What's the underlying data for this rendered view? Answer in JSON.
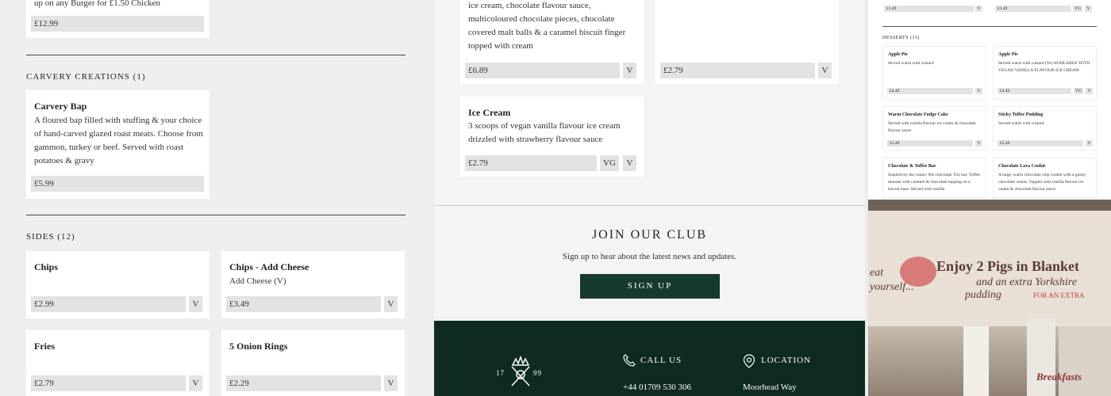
{
  "col1": {
    "top_desc": "up on any Burger for £1.50 Chicken",
    "top_price": "£12.99",
    "carvery_heading": "CARVERY CREATIONS (1)",
    "carvery": {
      "title": "Carvery Bap",
      "desc": "A floured bap filled with stuffing & your choice of hand-carved glazed roast meats. Choose from gammon, turkey or beef. Served with roast potatoes & gravy",
      "price": "£5.99"
    },
    "sides_heading": "SIDES (12)",
    "sides": [
      {
        "title": "Chips",
        "desc": "",
        "price": "£2.99",
        "badge": "V"
      },
      {
        "title": "Chips - Add Cheese",
        "desc": "Add Cheese (V)",
        "price": "£3.49",
        "badge": "V"
      },
      {
        "title": "Fries",
        "desc": "",
        "price": "£2.79",
        "badge": "V"
      },
      {
        "title": "5 Onion Rings",
        "desc": "",
        "price": "£2.29",
        "badge": "V"
      }
    ]
  },
  "col2": {
    "card1": {
      "desc": "ice cream, chocolate flavour sauce, multicoloured chocolate pieces, chocolate covered malt balls & a caramel biscuit finger topped with cream",
      "price": "£6.89",
      "badge": "V"
    },
    "card2": {
      "price": "£2.79",
      "badge": "V"
    },
    "icecream": {
      "title": "Ice Cream",
      "desc": "3 scoops of vegan vanilla flavour ice cream drizzled with strawberry flavour sauce",
      "price": "£2.79",
      "badge1": "VG",
      "badge2": "V"
    },
    "club": {
      "title": "JOIN OUR CLUB",
      "subtitle": "Sign up to hear about the latest news and updates.",
      "button": "SIGN UP"
    },
    "footer": {
      "logo_left": "17",
      "logo_right": "99",
      "call_label": "CALL US",
      "phone": "+44 01709 530 306",
      "location_label": "LOCATION",
      "address": "Moorhead Way"
    }
  },
  "col3": {
    "top_prices": [
      {
        "price": "£1.49",
        "badges": [
          "V"
        ]
      },
      {
        "price": "£1.49",
        "badges": [
          "VG",
          "V"
        ]
      }
    ],
    "desserts_heading": "DESSERTS (11)",
    "desserts": [
      {
        "title": "Apple Pie",
        "desc": "Served warm with custard",
        "price": "£4.49",
        "badges": [
          "V"
        ]
      },
      {
        "title": "Apple Pie",
        "desc": "Served warm with custard (Ve) AVAILABLE WITH VEGAN VANILLA FLAVOUR ICE CREAM",
        "price": "£4.49",
        "badges": [
          "VG",
          "V"
        ]
      },
      {
        "title": "Warm Chocolate Fudge Cake",
        "desc": "Served with vanilla flavour ice cream & chocolate flavour sauce",
        "price": "£5.49",
        "badges": [
          "V"
        ]
      },
      {
        "title": "Sticky Toffee Pudding",
        "desc": "Served warm with custard",
        "price": "£5.49",
        "badges": [
          "V"
        ]
      },
      {
        "title": "Chocolate & Toffee Bar",
        "desc": "Inspired by the classic 90s chocolate Trio bar. Toffee mousse with caramel & chocolate topping on a biscuit base. Served with vanilla",
        "price": "",
        "badges": []
      },
      {
        "title": "Chocolate Lava Cookie",
        "desc": "A large, warm chocolate chip cookie with a gooey chocolate centre. Topped with vanilla flavour ice cream & chocolate flavour sauce",
        "price": "",
        "badges": []
      }
    ],
    "photo": {
      "line1": "Enjoy 2 Pigs in Blanket",
      "line2": "and an extra Yorkshire",
      "line3": "pudding",
      "line4": "FOR AN EXTRA",
      "left_text": "eat yourself...",
      "sign": "Breakfasts"
    }
  }
}
